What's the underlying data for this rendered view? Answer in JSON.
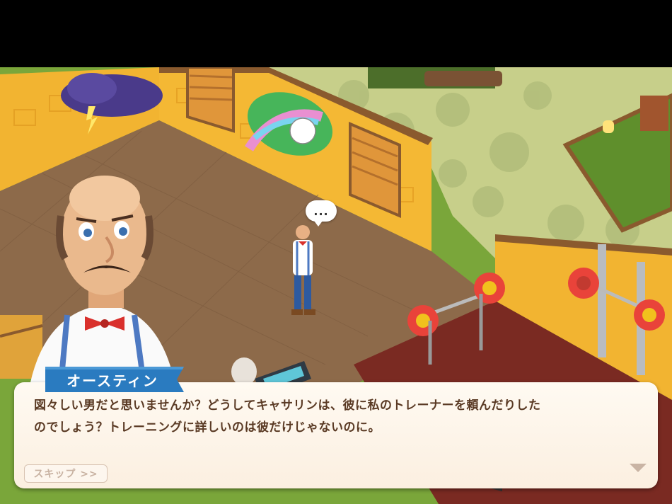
{
  "dialog": {
    "speaker": "オースティン",
    "line1": "図々しい男だと思いませんか？どうしてキャサリンは、彼に私のトレーナーを頼んだりした",
    "line2": "のでしょう？トレーニングに詳しいのは彼だけじゃないのに。",
    "skip_label": "スキップ >>"
  },
  "scene": {
    "thought_bubble": "..."
  },
  "colors": {
    "wall": "#f2b431",
    "floor": "#8d6a4a",
    "mat": "#7a2a22",
    "nameplate": "#2a7bc0",
    "dialog_text": "#5a3a24"
  }
}
